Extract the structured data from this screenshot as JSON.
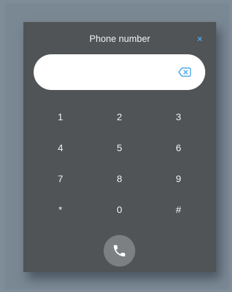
{
  "dialog": {
    "title": "Phone number",
    "close_icon": "close-icon",
    "close_glyph": "×"
  },
  "input": {
    "value": "",
    "placeholder": "",
    "backspace_icon": "backspace-icon"
  },
  "keypad": {
    "keys": [
      "1",
      "2",
      "3",
      "4",
      "5",
      "6",
      "7",
      "8",
      "9",
      "*",
      "0",
      "#"
    ]
  },
  "call": {
    "icon": "phone-icon"
  },
  "colors": {
    "background": "#7f8d99",
    "dialog": "#505456",
    "accent": "#4aa8e8",
    "call_button": "#7d8083"
  }
}
